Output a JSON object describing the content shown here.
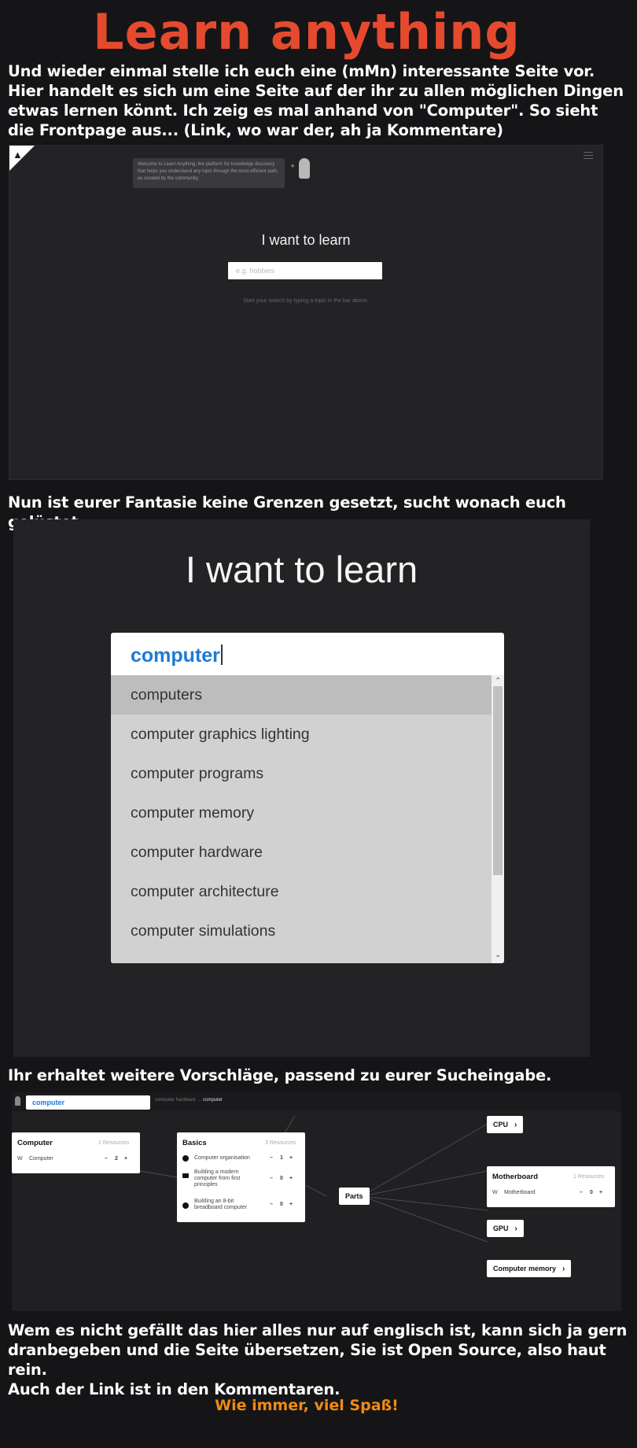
{
  "title": "Learn anything",
  "intro_lines": [
    "Und wieder einmal stelle ich euch eine (mMn) interessante Seite vor.",
    "Hier handelt es sich um eine Seite auf der ihr zu allen möglichen Dingen",
    "etwas lernen könnt. Ich zeig es mal anhand von \"Computer\". So sieht",
    "die Frontpage aus... (Link, wo war der, ah ja Kommentare)"
  ],
  "shot1": {
    "notice": "Welcome to Learn Anything, the platform for knowledge discovery that helps you understand any topic through the most efficient path, as curated by the community.",
    "heading": "I want to learn",
    "placeholder": "e.g. hobbies",
    "hint": "Start your search by typing a topic in the bar above."
  },
  "caption2": "Nun ist eurer Fantasie keine Grenzen gesetzt, sucht wonach euch gelüstet.",
  "shot2": {
    "heading": "I want to learn",
    "query": "computer",
    "suggestions": [
      "computers",
      "computer graphics lighting",
      "computer programs",
      "computer memory",
      "computer hardware",
      "computer architecture",
      "computer simulations"
    ]
  },
  "caption3": "Ihr erhaltet weitere Vorschläge, passend zu eurer Sucheingabe.",
  "shot3": {
    "search": "computer",
    "breadcrumb_prev": "computer hardware",
    "breadcrumb_sep": "→",
    "breadcrumb_current": "computer",
    "computer_card": {
      "title": "Computer",
      "resources": "1 Resources",
      "row": "Computer",
      "row_icon": "W",
      "votes": "2"
    },
    "basics_card": {
      "title": "Basics",
      "resources": "3 Resources",
      "rows": [
        {
          "label": "Computer organisation",
          "votes": "1"
        },
        {
          "label": "Building a modern computer from first principles",
          "votes": "0"
        },
        {
          "label": "Building an 8-bit breadboard computer",
          "votes": "0"
        }
      ]
    },
    "parts": "Parts",
    "cpu": "CPU",
    "motherboard_card": {
      "title": "Motherboard",
      "resources": "1 Resources",
      "row": "Motherboard",
      "row_icon": "W",
      "votes": "0"
    },
    "gpu": "GPU",
    "memory": "Computer memory",
    "minus": "–",
    "plus": "+"
  },
  "outro_lines": [
    "Wem es nicht gefällt das hier alles nur auf englisch ist, kann sich ja gern",
    "dranbegeben und die Seite übersetzen, Sie ist Open Source, also haut rein.",
    "Auch der Link ist in den Kommentaren."
  ],
  "footer": "Wie immer, viel Spaß!"
}
